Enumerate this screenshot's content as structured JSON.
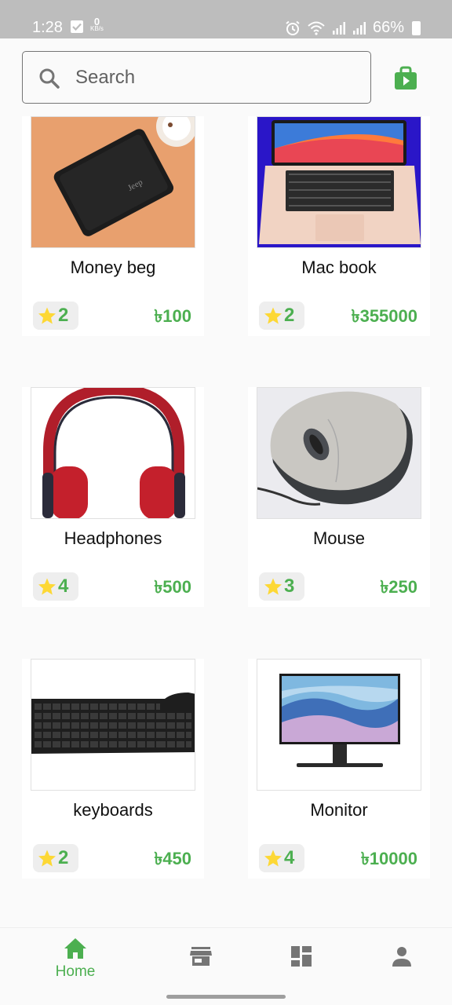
{
  "status_bar": {
    "time": "1:28",
    "net_speed_value": "0",
    "net_speed_unit": "KB/s",
    "battery": "66%"
  },
  "search": {
    "placeholder": "Search",
    "icon": "search-icon"
  },
  "cart": {
    "icon": "shopping-bag-icon",
    "color": "#4caf50"
  },
  "products": [
    {
      "name": "Money beg",
      "rating": "2",
      "price": "৳100"
    },
    {
      "name": "Mac book",
      "rating": "2",
      "price": "৳355000"
    },
    {
      "name": "Headphones",
      "rating": "4",
      "price": "৳500"
    },
    {
      "name": "Mouse",
      "rating": "3",
      "price": "৳250"
    },
    {
      "name": "keyboards",
      "rating": "2",
      "price": "৳450"
    },
    {
      "name": "Monitor",
      "rating": "4",
      "price": "৳10000"
    }
  ],
  "bottom_nav": {
    "items": [
      {
        "label": "Home",
        "icon": "home-icon",
        "active": true
      },
      {
        "label": "",
        "icon": "store-icon",
        "active": false
      },
      {
        "label": "",
        "icon": "dashboard-icon",
        "active": false
      },
      {
        "label": "",
        "icon": "person-icon",
        "active": false
      }
    ]
  },
  "colors": {
    "accent": "#4caf50",
    "inactive_icon": "#757575",
    "star": "#fdd835"
  }
}
